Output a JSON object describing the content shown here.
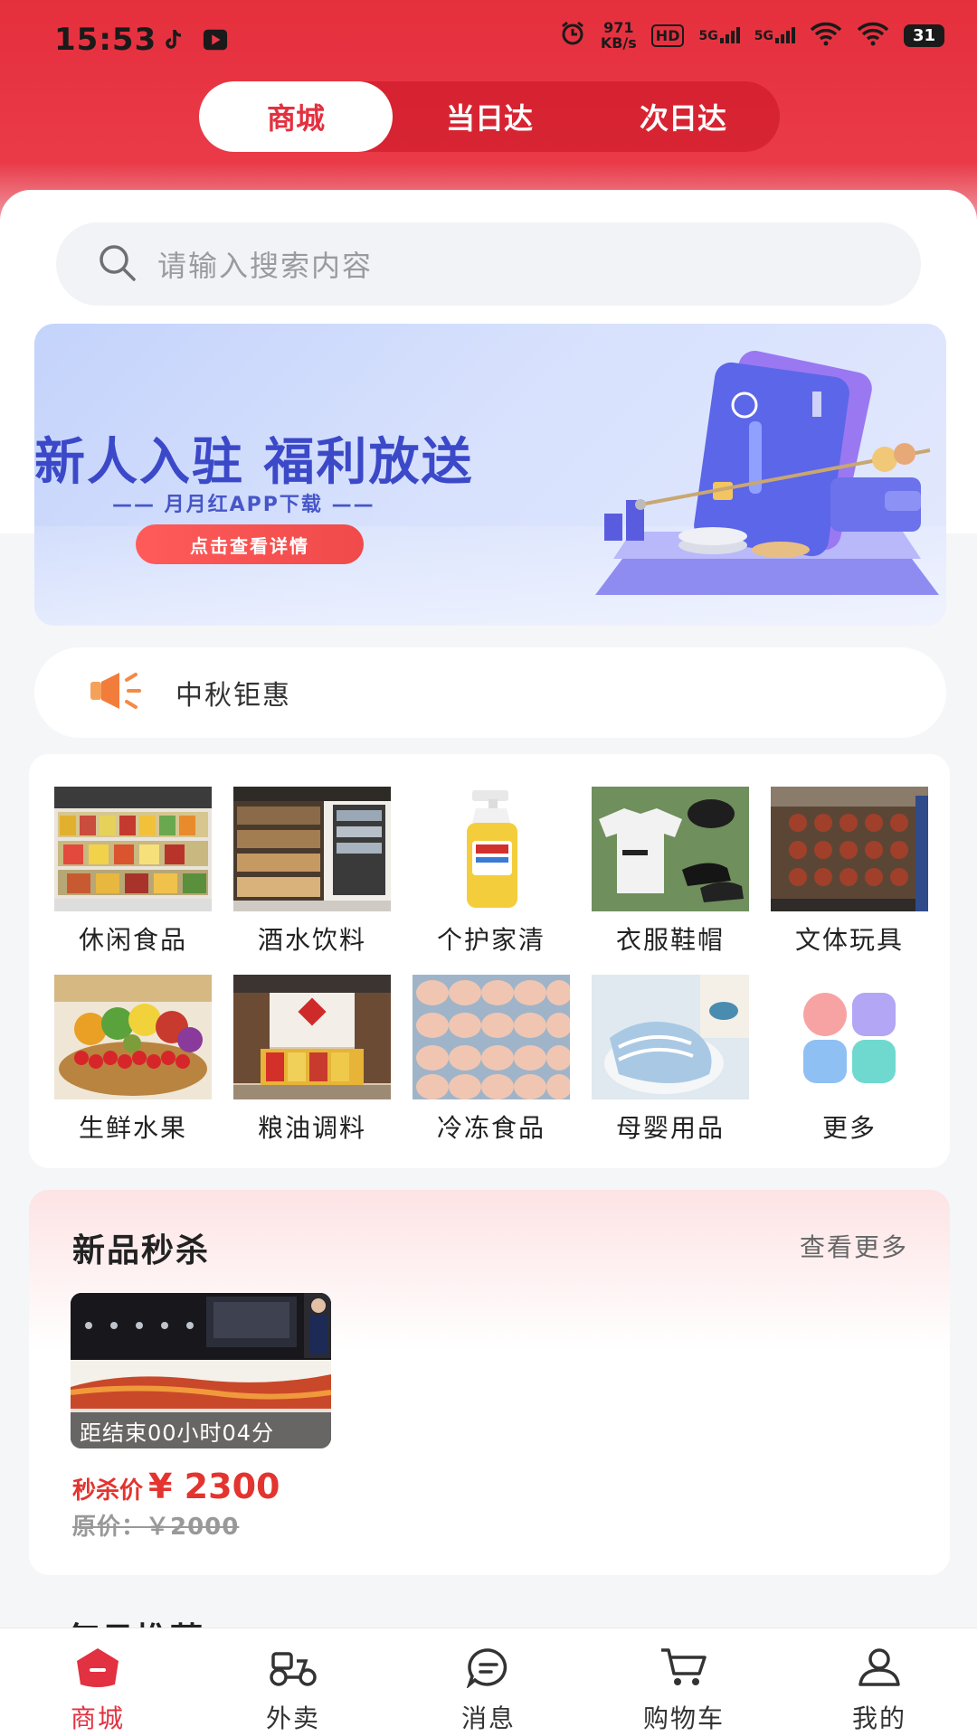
{
  "status_bar": {
    "time": "15:53",
    "net_speed_value": "971",
    "net_speed_unit": "KB/s",
    "hd_badge": "HD",
    "signal1": "5G",
    "signal2": "5G",
    "battery": "31"
  },
  "top_tabs": [
    {
      "label": "商城",
      "active": true
    },
    {
      "label": "当日达",
      "active": false
    },
    {
      "label": "次日达",
      "active": false
    }
  ],
  "search": {
    "placeholder": "请输入搜索内容"
  },
  "banner": {
    "title": "新人入驻 福利放送",
    "subtitle": "—— 月月红APP下载 ——",
    "button": "点击查看详情"
  },
  "notice": {
    "text": "中秋钜惠",
    "icon": "speaker-icon"
  },
  "categories": [
    {
      "label": "休闲食品"
    },
    {
      "label": "酒水饮料"
    },
    {
      "label": "个护家清"
    },
    {
      "label": "衣服鞋帽"
    },
    {
      "label": "文体玩具"
    },
    {
      "label": "生鲜水果"
    },
    {
      "label": "粮油调料"
    },
    {
      "label": "冷冻食品"
    },
    {
      "label": "母婴用品"
    },
    {
      "label": "更多"
    }
  ],
  "flash_sale": {
    "title": "新品秒杀",
    "more": "查看更多",
    "timer": "距结束00小时04分",
    "price_label": "秒杀价",
    "price": "¥ 2300",
    "original": "原价：￥2000"
  },
  "next_section_title": "每日推荐",
  "bottom_tabs": [
    {
      "label": "商城",
      "icon": "home-icon",
      "active": true
    },
    {
      "label": "外卖",
      "icon": "scooter-icon",
      "active": false
    },
    {
      "label": "消息",
      "icon": "message-icon",
      "active": false
    },
    {
      "label": "购物车",
      "icon": "cart-icon",
      "active": false
    },
    {
      "label": "我的",
      "icon": "user-icon",
      "active": false
    }
  ],
  "colors": {
    "brand_red": "#e23140",
    "banner_blue": "#3b49c9",
    "price_red": "#e3342f"
  }
}
